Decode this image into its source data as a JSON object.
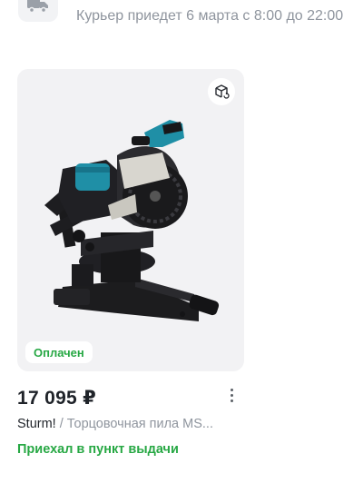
{
  "delivery": {
    "icon": "truck-icon",
    "text": "Курьер приедет 6 марта с 8:00 до 22:00"
  },
  "product": {
    "image_alt": "Торцовочная пила",
    "hint_icon": "box-exchange-icon",
    "badge": "Оплачен",
    "price": "17 095 ₽",
    "brand": "Sturm!",
    "title_rest": " / Торцовочная пила MS...",
    "status": "Приехал в пункт выдачи",
    "colors": {
      "accent_green": "#27a844",
      "tool_teal": "#1f8fa6"
    }
  }
}
